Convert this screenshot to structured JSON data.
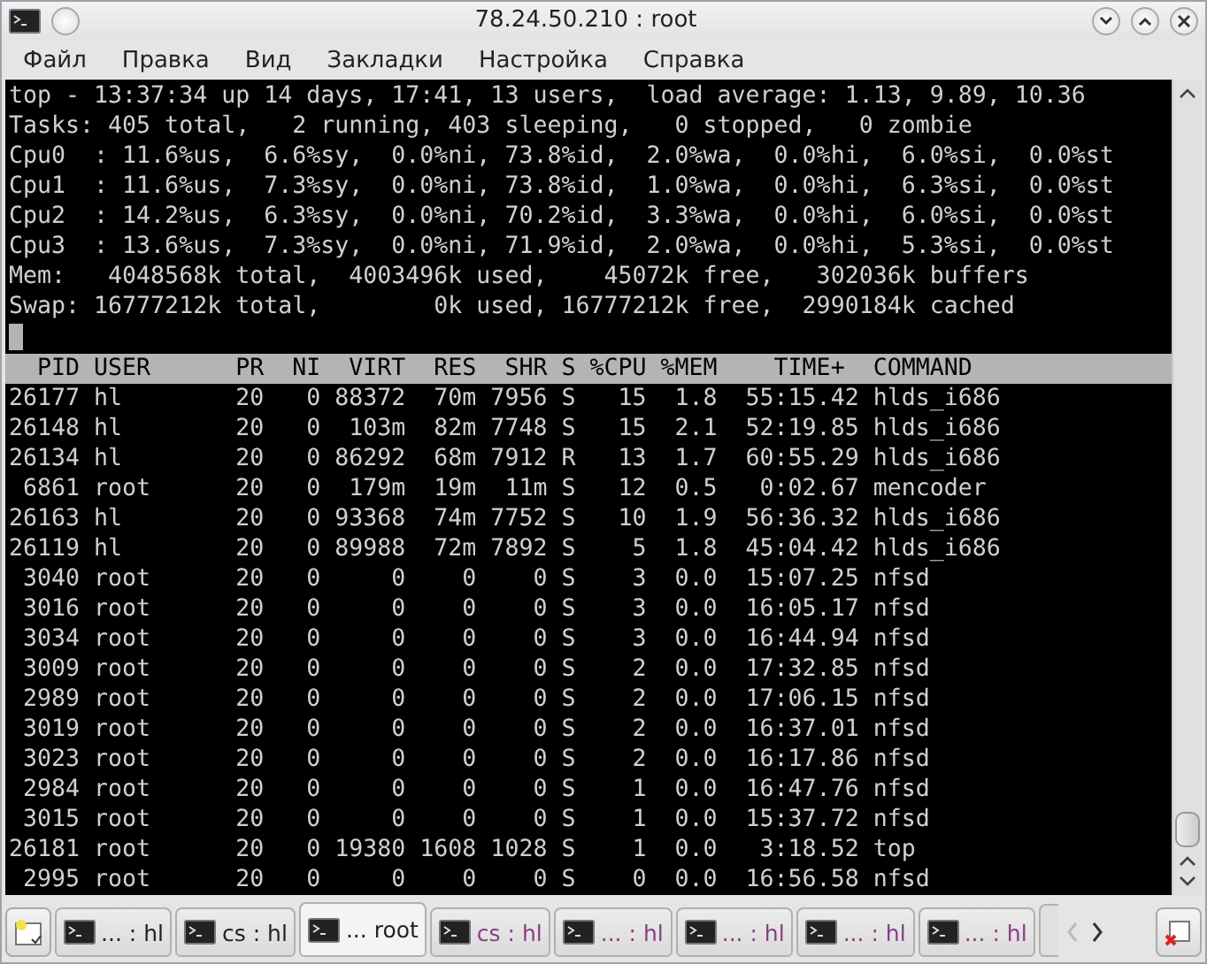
{
  "window": {
    "title": "78.24.50.210 : root"
  },
  "menu": [
    "Файл",
    "Правка",
    "Вид",
    "Закладки",
    "Настройка",
    "Справка"
  ],
  "terminal": {
    "summary": [
      "top - 13:37:34 up 14 days, 17:41, 13 users,  load average: 1.13, 9.89, 10.36",
      "Tasks: 405 total,   2 running, 403 sleeping,   0 stopped,   0 zombie",
      "Cpu0  : 11.6%us,  6.6%sy,  0.0%ni, 73.8%id,  2.0%wa,  0.0%hi,  6.0%si,  0.0%st",
      "Cpu1  : 11.6%us,  7.3%sy,  0.0%ni, 73.8%id,  1.0%wa,  0.0%hi,  6.3%si,  0.0%st",
      "Cpu2  : 14.2%us,  6.3%sy,  0.0%ni, 70.2%id,  3.3%wa,  0.0%hi,  6.0%si,  0.0%st",
      "Cpu3  : 13.6%us,  7.3%sy,  0.0%ni, 71.9%id,  2.0%wa,  0.0%hi,  5.3%si,  0.0%st",
      "Mem:   4048568k total,  4003496k used,    45072k free,   302036k buffers",
      "Swap: 16777212k total,        0k used, 16777212k free,  2990184k cached"
    ],
    "header": "  PID USER      PR  NI  VIRT  RES  SHR S %CPU %MEM    TIME+  COMMAND",
    "rows": [
      "26177 hl        20   0 88372  70m 7956 S   15  1.8  55:15.42 hlds_i686",
      "26148 hl        20   0  103m  82m 7748 S   15  2.1  52:19.85 hlds_i686",
      "26134 hl        20   0 86292  68m 7912 R   13  1.7  60:55.29 hlds_i686",
      " 6861 root      20   0  179m  19m  11m S   12  0.5   0:02.67 mencoder",
      "26163 hl        20   0 93368  74m 7752 S   10  1.9  56:36.32 hlds_i686",
      "26119 hl        20   0 89988  72m 7892 S    5  1.8  45:04.42 hlds_i686",
      " 3040 root      20   0     0    0    0 S    3  0.0  15:07.25 nfsd",
      " 3016 root      20   0     0    0    0 S    3  0.0  16:05.17 nfsd",
      " 3034 root      20   0     0    0    0 S    3  0.0  16:44.94 nfsd",
      " 3009 root      20   0     0    0    0 S    2  0.0  17:32.85 nfsd",
      " 2989 root      20   0     0    0    0 S    2  0.0  17:06.15 nfsd",
      " 3019 root      20   0     0    0    0 S    2  0.0  16:37.01 nfsd",
      " 3023 root      20   0     0    0    0 S    2  0.0  16:17.86 nfsd",
      " 2984 root      20   0     0    0    0 S    1  0.0  16:47.76 nfsd",
      " 3015 root      20   0     0    0    0 S    1  0.0  15:37.72 nfsd",
      "26181 root      20   0 19380 1608 1028 S    1  0.0   3:18.52 top",
      " 2995 root      20   0     0    0    0 S    0  0.0  16:56.58 nfsd"
    ]
  },
  "tabs": [
    {
      "label": "... : hl",
      "selected": false,
      "activity": false
    },
    {
      "label": "cs : hl",
      "selected": false,
      "activity": false
    },
    {
      "label": "... root",
      "selected": true,
      "activity": false
    },
    {
      "label": "cs : hl",
      "selected": false,
      "activity": true
    },
    {
      "label": "... : hl",
      "selected": false,
      "activity": true
    },
    {
      "label": "... : hl",
      "selected": false,
      "activity": true
    },
    {
      "label": "... : hl",
      "selected": false,
      "activity": true
    },
    {
      "label": "... : hl",
      "selected": false,
      "activity": true
    }
  ]
}
